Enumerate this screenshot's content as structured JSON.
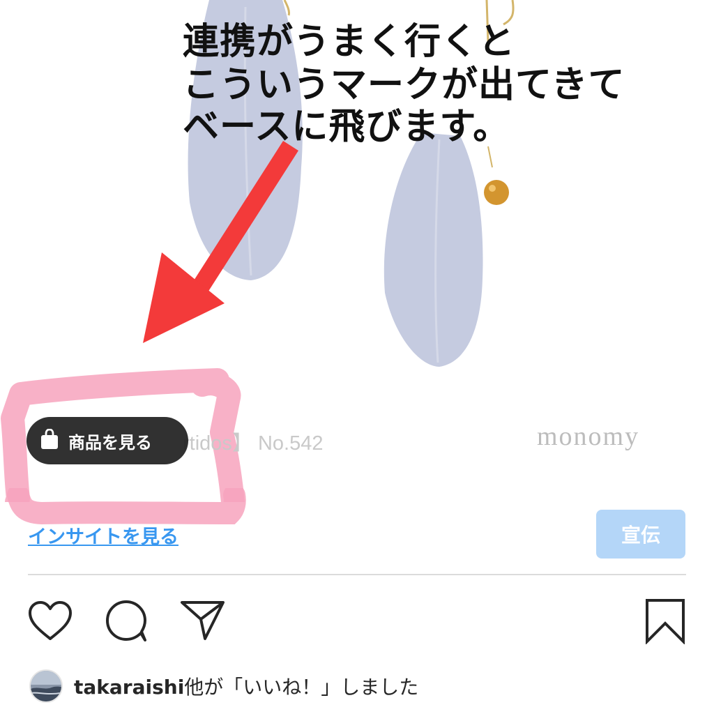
{
  "annotation": {
    "lines": [
      "連携がうまく行くと",
      "こういうマークが出てきて",
      "ベースに飛びます。"
    ],
    "arrow_color": "#f33a3a",
    "highlight_color": "#f7a3bd"
  },
  "photo": {
    "caption": "rtidos】 No.542",
    "brand": "monomy"
  },
  "shop_tag": {
    "icon": "shopping-bag-icon",
    "label": "商品を見る"
  },
  "insights": {
    "label": "インサイトを見る",
    "color": "#3897f0"
  },
  "promote": {
    "label": "宣伝",
    "color": "#b4d6f8"
  },
  "actions": {
    "icons": [
      "heart-icon",
      "comment-icon",
      "share-icon",
      "bookmark-icon"
    ]
  },
  "likes": {
    "username": "takaraishi",
    "suffix": "他が「いいね！」しました"
  }
}
